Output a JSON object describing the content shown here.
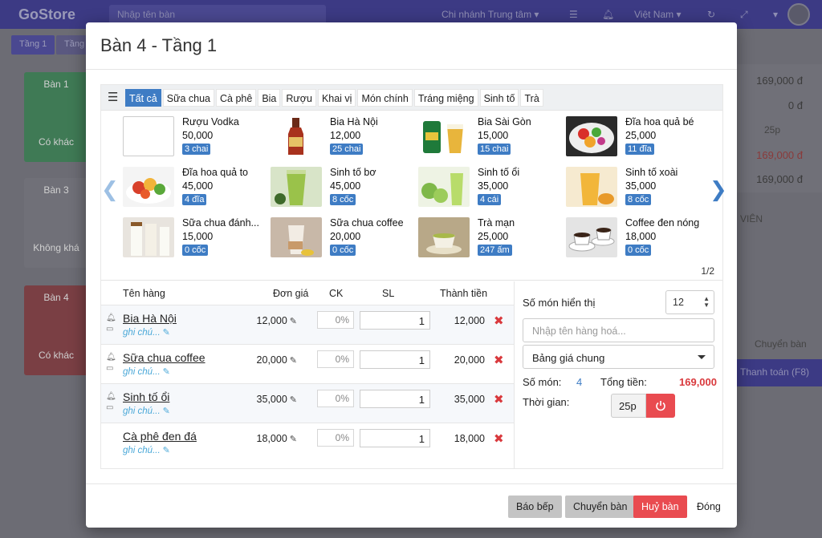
{
  "background": {
    "logo": "GoStore",
    "search_placeholder": "Nhập tên bàn",
    "branch": "Chi nhánh Trung tâm",
    "language": "Việt Nam",
    "tabs": [
      "Tầng 1",
      "Tầng"
    ],
    "tables": [
      {
        "name": "Bàn 1",
        "status": "Có khác"
      },
      {
        "name": "Bàn 3",
        "status": "Không khá"
      },
      {
        "name": "Bàn 4",
        "status": "Có khác"
      }
    ],
    "right_values": [
      "169,000 đ",
      "0 đ",
      "169,000 đ",
      "169,000 đ"
    ],
    "right_time": "25p",
    "right_label": "VIÊN",
    "right_button": "Chuyển bàn",
    "right_pay": "Thanh toán (F8)"
  },
  "modal": {
    "title": "Bàn 4 - Tầng 1",
    "categories": [
      "Tất cả",
      "Sữa chua",
      "Cà phê",
      "Bia",
      "Rượu",
      "Khai vị",
      "Món chính",
      "Tráng miệng",
      "Sinh tố",
      "Trà"
    ],
    "active_category": "Tất cả",
    "products": [
      {
        "name": "Rượu Vodka",
        "price": "50,000",
        "stock": "3 chai"
      },
      {
        "name": "Bia Hà Nội",
        "price": "12,000",
        "stock": "25 chai"
      },
      {
        "name": "Bia Sài Gòn",
        "price": "15,000",
        "stock": "15 chai"
      },
      {
        "name": "Đĩa hoa quả bé",
        "price": "25,000",
        "stock": "11 đĩa"
      },
      {
        "name": "Đĩa hoa quả to",
        "price": "45,000",
        "stock": "4 đĩa"
      },
      {
        "name": "Sinh tố bơ",
        "price": "45,000",
        "stock": "8 cốc"
      },
      {
        "name": "Sinh tố ổi",
        "price": "35,000",
        "stock": "4 cái"
      },
      {
        "name": "Sinh tố xoài",
        "price": "35,000",
        "stock": "8 cốc"
      },
      {
        "name": "Sữa chua đánh...",
        "price": "15,000",
        "stock": "0 cốc"
      },
      {
        "name": "Sữa chua coffee",
        "price": "20,000",
        "stock": "0 cốc"
      },
      {
        "name": "Trà mạn",
        "price": "25,000",
        "stock": "247 ấm"
      },
      {
        "name": "Coffee đen nóng",
        "price": "18,000",
        "stock": "0 cốc"
      }
    ],
    "page_indicator": "1/2",
    "order_headers": {
      "name": "Tên hàng",
      "price": "Đơn giá",
      "ck": "CK",
      "qty": "SL",
      "total": "Thành tiền"
    },
    "order_items": [
      {
        "name": "Bia Hà Nội",
        "note": "ghi chú...",
        "price": "12,000",
        "ck": "0%",
        "qty": "1",
        "total": "12,000"
      },
      {
        "name": "Sữa chua coffee",
        "note": "ghi chú...",
        "price": "20,000",
        "ck": "0%",
        "qty": "1",
        "total": "20,000"
      },
      {
        "name": "Sinh tố ổi",
        "note": "ghi chú...",
        "price": "35,000",
        "ck": "0%",
        "qty": "1",
        "total": "35,000"
      },
      {
        "name": "Cà phê đen đá",
        "note": "ghi chú...",
        "price": "18,000",
        "ck": "0%",
        "qty": "1",
        "total": "18,000"
      }
    ],
    "summary": {
      "display_count_label": "Số món hiển thị",
      "display_count_value": "12",
      "search_placeholder": "Nhập tên hàng hoá...",
      "price_list": "Bảng giá chung",
      "item_count_label": "Số món:",
      "item_count": "4",
      "total_label": "Tổng tiền:",
      "total": "169,000",
      "time_label": "Thời gian:",
      "time_value": "25p"
    },
    "footer": {
      "kitchen": "Báo bếp",
      "move_table": "Chuyển bàn",
      "cancel_table": "Huỷ bàn",
      "close": "Đóng"
    },
    "colors": {
      "accent": "#3e7cc4",
      "danger": "#e94b50",
      "header_bg": "#3c3a84"
    }
  }
}
